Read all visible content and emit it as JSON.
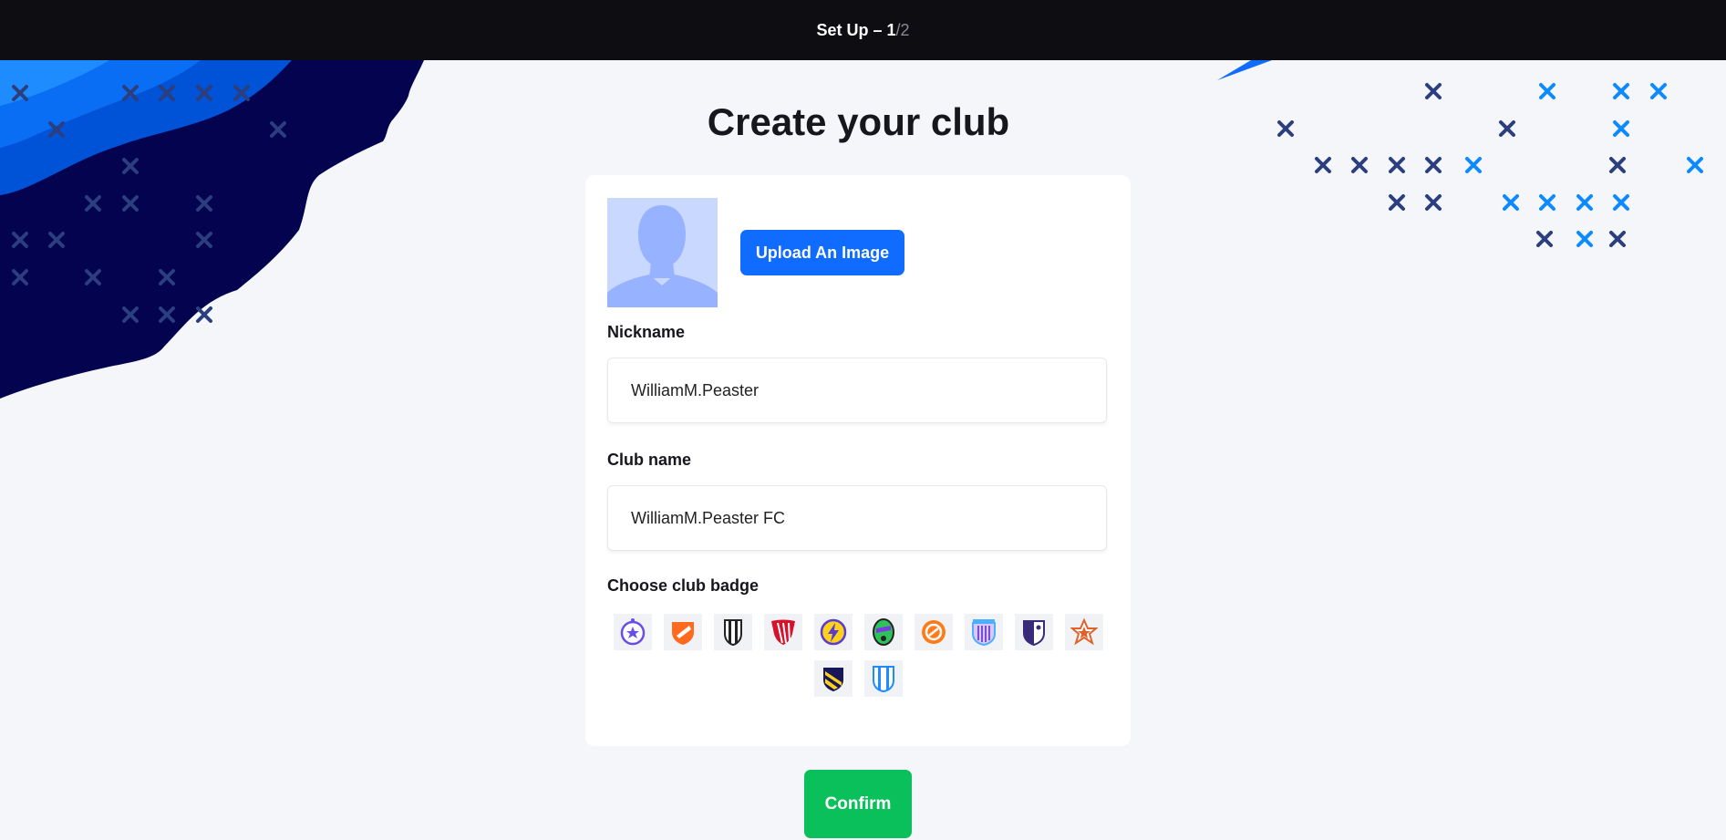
{
  "header": {
    "step_prefix": "Set Up",
    "separator": "–",
    "current_step": "1",
    "total_steps": "/2"
  },
  "page": {
    "title": "Create your club"
  },
  "avatar": {
    "icon": "person-silhouette-icon"
  },
  "upload": {
    "label": "Upload An Image"
  },
  "nickname": {
    "label": "Nickname",
    "value": "WilliamM.Peaster"
  },
  "club_name": {
    "label": "Club name",
    "value": "WilliamM.Peaster FC"
  },
  "badges": {
    "label": "Choose club badge",
    "items": [
      "soccer-star-badge-icon",
      "orange-shield-badge-icon",
      "striped-shield-badge-icon",
      "red-stripes-badge-icon",
      "lightning-badge-icon",
      "green-oval-badge-icon",
      "orange-ball-badge-icon",
      "castle-shield-badge-icon",
      "purple-half-shield-badge-icon",
      "star-badge-icon",
      "yellow-stripe-shield-badge-icon",
      "blue-stripes-badge-icon"
    ]
  },
  "confirm": {
    "label": "Confirm"
  },
  "colors": {
    "accent_blue": "#0f6cff",
    "confirm_green": "#0ac05a",
    "topbar": "#0d0d12",
    "navy": "#03034f"
  }
}
